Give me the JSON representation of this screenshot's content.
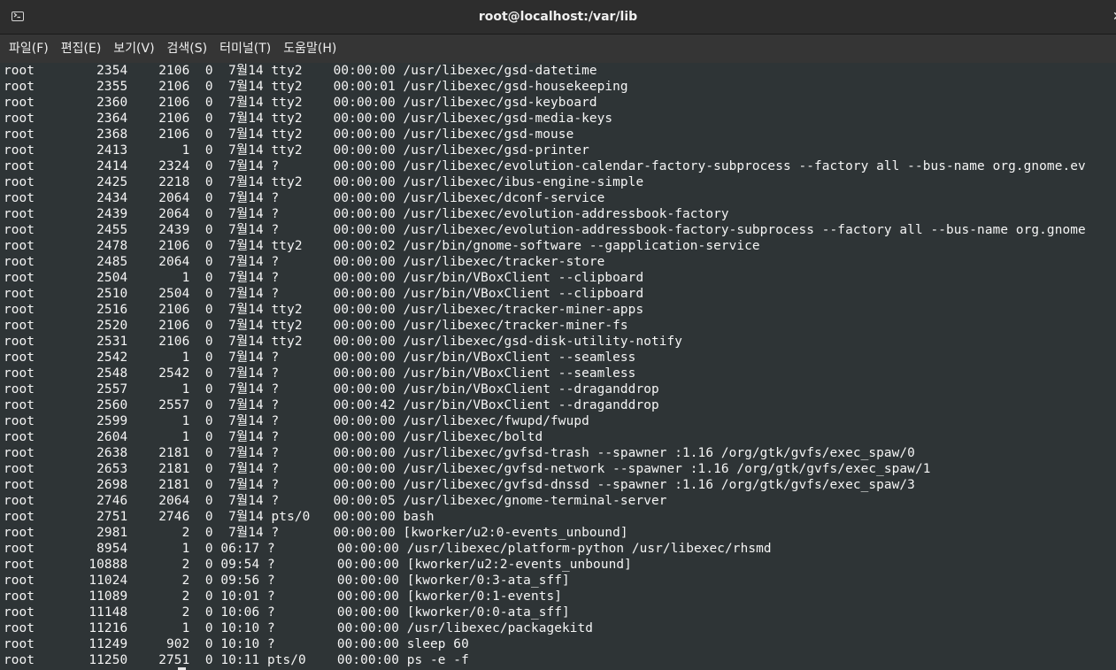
{
  "window": {
    "title": "root@localhost:/var/lib"
  },
  "icons": {
    "terminal": "terminal-icon",
    "close": "close-icon"
  },
  "colors": {
    "titlebar": "#2d2d2d",
    "menubar": "#353535",
    "terminal_bg": "#2e3436",
    "text": "#f5f5f5"
  },
  "menu": [
    {
      "label": "파일(F)"
    },
    {
      "label": "편집(E)"
    },
    {
      "label": "보기(V)"
    },
    {
      "label": "검색(S)"
    },
    {
      "label": "터미널(T)"
    },
    {
      "label": "도움말(H)"
    }
  ],
  "terminal": {
    "lines": [
      "root        2354    2106  0  7월14 tty2    00:00:00 /usr/libexec/gsd-datetime",
      "root        2355    2106  0  7월14 tty2    00:00:01 /usr/libexec/gsd-housekeeping",
      "root        2360    2106  0  7월14 tty2    00:00:00 /usr/libexec/gsd-keyboard",
      "root        2364    2106  0  7월14 tty2    00:00:00 /usr/libexec/gsd-media-keys",
      "root        2368    2106  0  7월14 tty2    00:00:00 /usr/libexec/gsd-mouse",
      "root        2413       1  0  7월14 tty2    00:00:00 /usr/libexec/gsd-printer",
      "root        2414    2324  0  7월14 ?       00:00:00 /usr/libexec/evolution-calendar-factory-subprocess --factory all --bus-name org.gnome.ev",
      "root        2425    2218  0  7월14 tty2    00:00:00 /usr/libexec/ibus-engine-simple",
      "root        2434    2064  0  7월14 ?       00:00:00 /usr/libexec/dconf-service",
      "root        2439    2064  0  7월14 ?       00:00:00 /usr/libexec/evolution-addressbook-factory",
      "root        2455    2439  0  7월14 ?       00:00:00 /usr/libexec/evolution-addressbook-factory-subprocess --factory all --bus-name org.gnome",
      "root        2478    2106  0  7월14 tty2    00:00:02 /usr/bin/gnome-software --gapplication-service",
      "root        2485    2064  0  7월14 ?       00:00:00 /usr/libexec/tracker-store",
      "root        2504       1  0  7월14 ?       00:00:00 /usr/bin/VBoxClient --clipboard",
      "root        2510    2504  0  7월14 ?       00:00:00 /usr/bin/VBoxClient --clipboard",
      "root        2516    2106  0  7월14 tty2    00:00:00 /usr/libexec/tracker-miner-apps",
      "root        2520    2106  0  7월14 tty2    00:00:00 /usr/libexec/tracker-miner-fs",
      "root        2531    2106  0  7월14 tty2    00:00:00 /usr/libexec/gsd-disk-utility-notify",
      "root        2542       1  0  7월14 ?       00:00:00 /usr/bin/VBoxClient --seamless",
      "root        2548    2542  0  7월14 ?       00:00:00 /usr/bin/VBoxClient --seamless",
      "root        2557       1  0  7월14 ?       00:00:00 /usr/bin/VBoxClient --draganddrop",
      "root        2560    2557  0  7월14 ?       00:00:42 /usr/bin/VBoxClient --draganddrop",
      "root        2599       1  0  7월14 ?       00:00:00 /usr/libexec/fwupd/fwupd",
      "root        2604       1  0  7월14 ?       00:00:00 /usr/libexec/boltd",
      "root        2638    2181  0  7월14 ?       00:00:00 /usr/libexec/gvfsd-trash --spawner :1.16 /org/gtk/gvfs/exec_spaw/0",
      "root        2653    2181  0  7월14 ?       00:00:00 /usr/libexec/gvfsd-network --spawner :1.16 /org/gtk/gvfs/exec_spaw/1",
      "root        2698    2181  0  7월14 ?       00:00:00 /usr/libexec/gvfsd-dnssd --spawner :1.16 /org/gtk/gvfs/exec_spaw/3",
      "root        2746    2064  0  7월14 ?       00:00:05 /usr/libexec/gnome-terminal-server",
      "root        2751    2746  0  7월14 pts/0   00:00:00 bash",
      "root        2981       2  0  7월14 ?       00:00:00 [kworker/u2:0-events_unbound]",
      "root        8954       1  0 06:17 ?        00:00:00 /usr/libexec/platform-python /usr/libexec/rhsmd",
      "root       10888       2  0 09:54 ?        00:00:00 [kworker/u2:2-events_unbound]",
      "root       11024       2  0 09:56 ?        00:00:00 [kworker/0:3-ata_sff]",
      "root       11089       2  0 10:01 ?        00:00:00 [kworker/0:1-events]",
      "root       11148       2  0 10:06 ?        00:00:00 [kworker/0:0-ata_sff]",
      "root       11216       1  0 10:10 ?        00:00:00 /usr/libexec/packagekitd",
      "root       11249     902  0 10:10 ?        00:00:00 sleep 60",
      "root       11250    2751  0 10:11 pts/0    00:00:00 ps -e -f"
    ]
  }
}
